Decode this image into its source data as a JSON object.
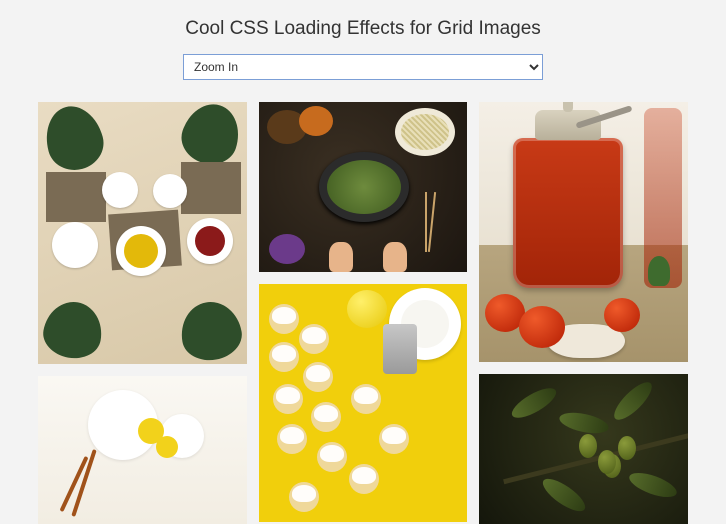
{
  "header": {
    "title": "Cool CSS Loading Effects for Grid Images"
  },
  "controls": {
    "effect_selected": "Zoom In"
  }
}
